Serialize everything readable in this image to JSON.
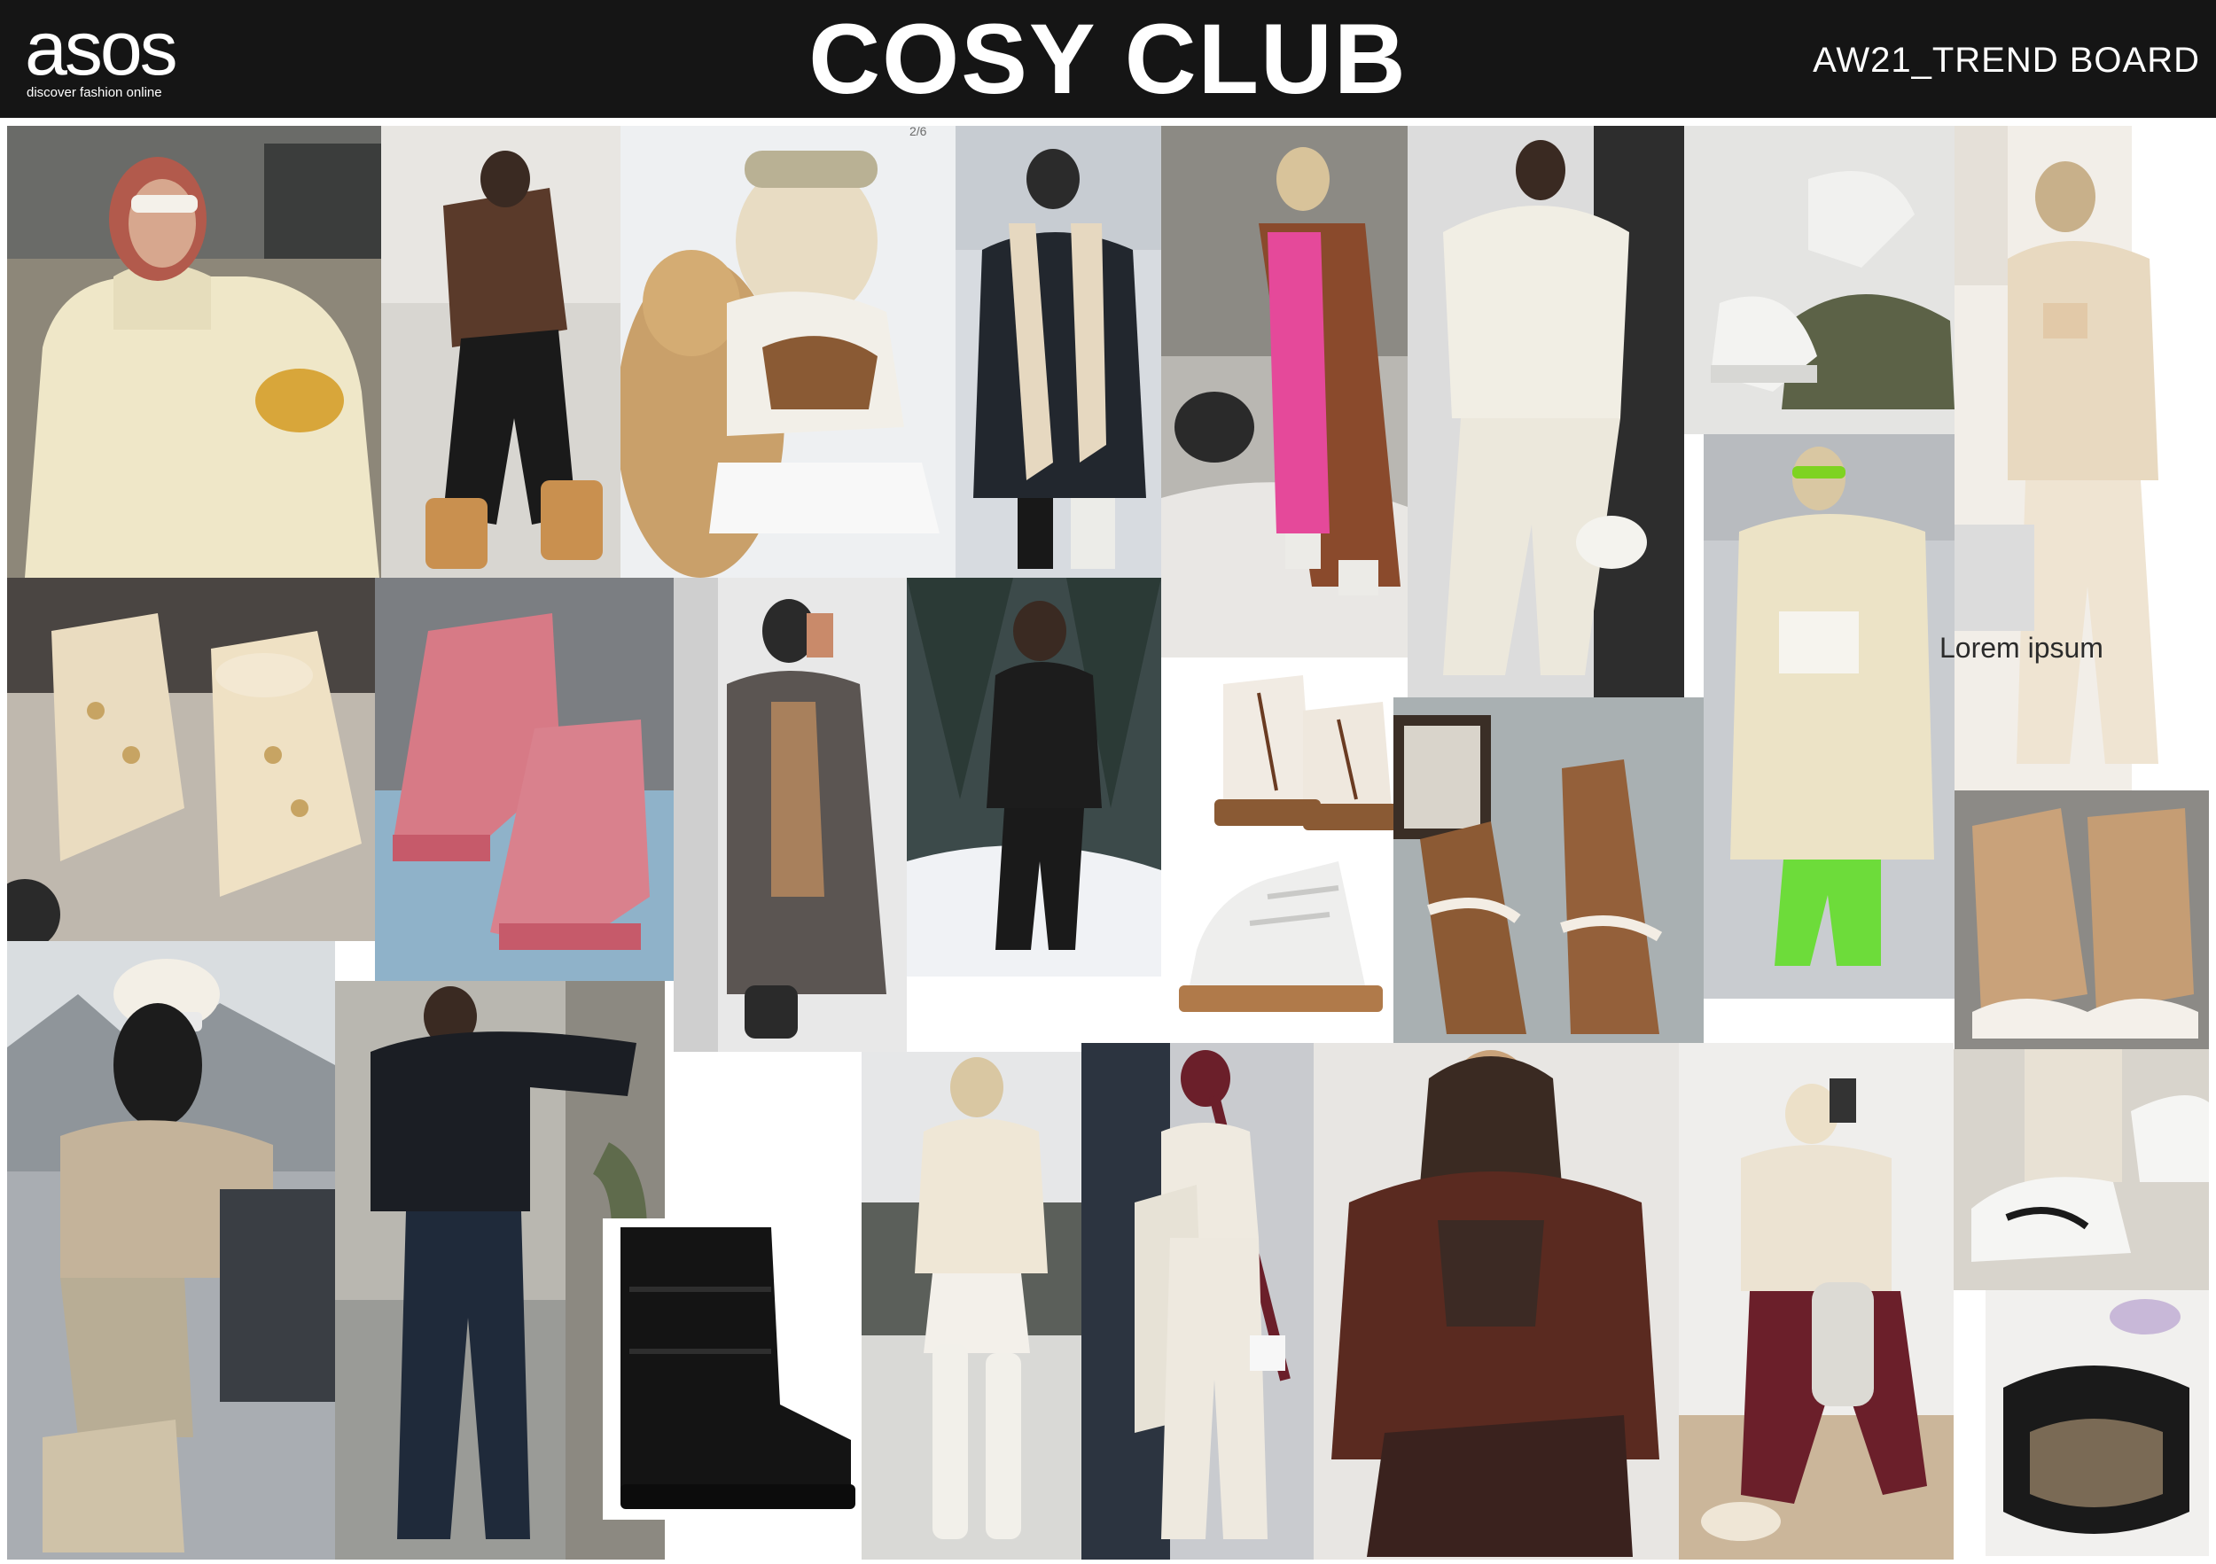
{
  "header": {
    "logo": "asos",
    "tagline": "discover fashion online",
    "title": "COSY CLUB",
    "board_label": "AW21_TREND BOARD"
  },
  "overlay_text": "Lorem ipsum",
  "carousel_counter": "2/6",
  "colors": {
    "header_bg": "#151515",
    "header_text": "#ffffff",
    "board_bg": "#ffffff",
    "palette": [
      "#efe6cc",
      "#5a3a2a",
      "#1c1c1c",
      "#e5499a",
      "#d77a86",
      "#8a4a2c",
      "#c9a27a",
      "#6b1f2a"
    ]
  }
}
